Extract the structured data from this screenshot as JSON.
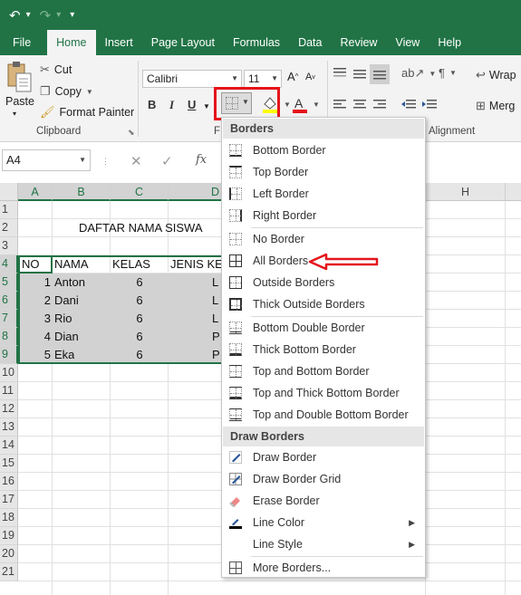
{
  "quick_access": {
    "undo": "↶",
    "redo": "↷",
    "customize": "▾"
  },
  "tabs": [
    "File",
    "Home",
    "Insert",
    "Page Layout",
    "Formulas",
    "Data",
    "Review",
    "View",
    "Help"
  ],
  "ribbon": {
    "paste": "Paste",
    "cut": "Cut",
    "copy": "Copy",
    "format_painter": "Format Painter",
    "clipboard_label": "Clipboard",
    "font_name": "Calibri",
    "font_size": "11",
    "bold": "B",
    "italic": "I",
    "underline": "U",
    "font_group_partial": "F",
    "wrap": "Wrap",
    "merge": "Merg",
    "alignment_label": "Alignment"
  },
  "formula_bar": {
    "name_box": "A4",
    "fx": "fx"
  },
  "columns": [
    "A",
    "B",
    "C",
    "D",
    "H"
  ],
  "rows": [
    "1",
    "2",
    "3",
    "4",
    "5",
    "6",
    "7",
    "8",
    "9",
    "10",
    "11",
    "12",
    "13",
    "14",
    "15",
    "16",
    "17",
    "18",
    "19",
    "20",
    "21"
  ],
  "sheet": {
    "title": "DAFTAR NAMA SISWA",
    "headers": [
      "NO",
      "NAMA",
      "KELAS",
      "JENIS KEL"
    ],
    "data": [
      [
        "1",
        "Anton",
        "6",
        "L"
      ],
      [
        "2",
        "Dani",
        "6",
        "L"
      ],
      [
        "3",
        "Rio",
        "6",
        "L"
      ],
      [
        "4",
        "Dian",
        "6",
        "P"
      ],
      [
        "5",
        "Eka",
        "6",
        "P"
      ]
    ]
  },
  "borders_menu": {
    "header": "Borders",
    "items": [
      "Bottom Border",
      "Top Border",
      "Left Border",
      "Right Border",
      "No Border",
      "All Borders",
      "Outside Borders",
      "Thick Outside Borders",
      "Bottom Double Border",
      "Thick Bottom Border",
      "Top and Bottom Border",
      "Top and Thick Bottom Border",
      "Top and Double Bottom Border"
    ],
    "draw_header": "Draw Borders",
    "draw_items": [
      "Draw Border",
      "Draw Border Grid",
      "Erase Border",
      "Line Color",
      "Line Style",
      "More Borders..."
    ]
  },
  "colors": {
    "excel_green": "#217346",
    "highlight_red": "#e5141b",
    "selection_gray": "#d2d2d2"
  }
}
